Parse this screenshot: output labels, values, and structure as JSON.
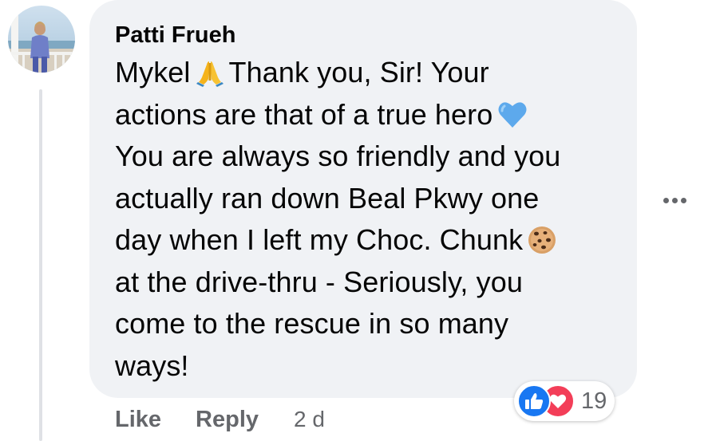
{
  "comment": {
    "author": "Patti Frueh",
    "text_lines": [
      "Mykel",
      "Thank you, Sir! Your",
      "actions are that of a true hero",
      "You are always so friendly and you",
      "actually ran down Beal Pkwy one",
      "day when I left my Choc. Chunk",
      "at the drive-thru - Seriously, you",
      "come to the rescue in so many",
      "ways!"
    ],
    "emojis": [
      "folded-hands-emoji",
      "blue-heart-emoji",
      "cookie-emoji"
    ]
  },
  "reactions": {
    "types": [
      "like-icon",
      "love-icon"
    ],
    "count": "19",
    "colors": {
      "like": "#1877f2",
      "love": "#f33e58"
    }
  },
  "actions": {
    "like_label": "Like",
    "reply_label": "Reply",
    "timestamp": "2 d"
  },
  "more_menu_icon": "more-options-icon",
  "colors": {
    "bubble": "#f0f2f5",
    "text": "#050505",
    "secondary_text": "#65676b",
    "thread_line": "#dfe1e5"
  }
}
